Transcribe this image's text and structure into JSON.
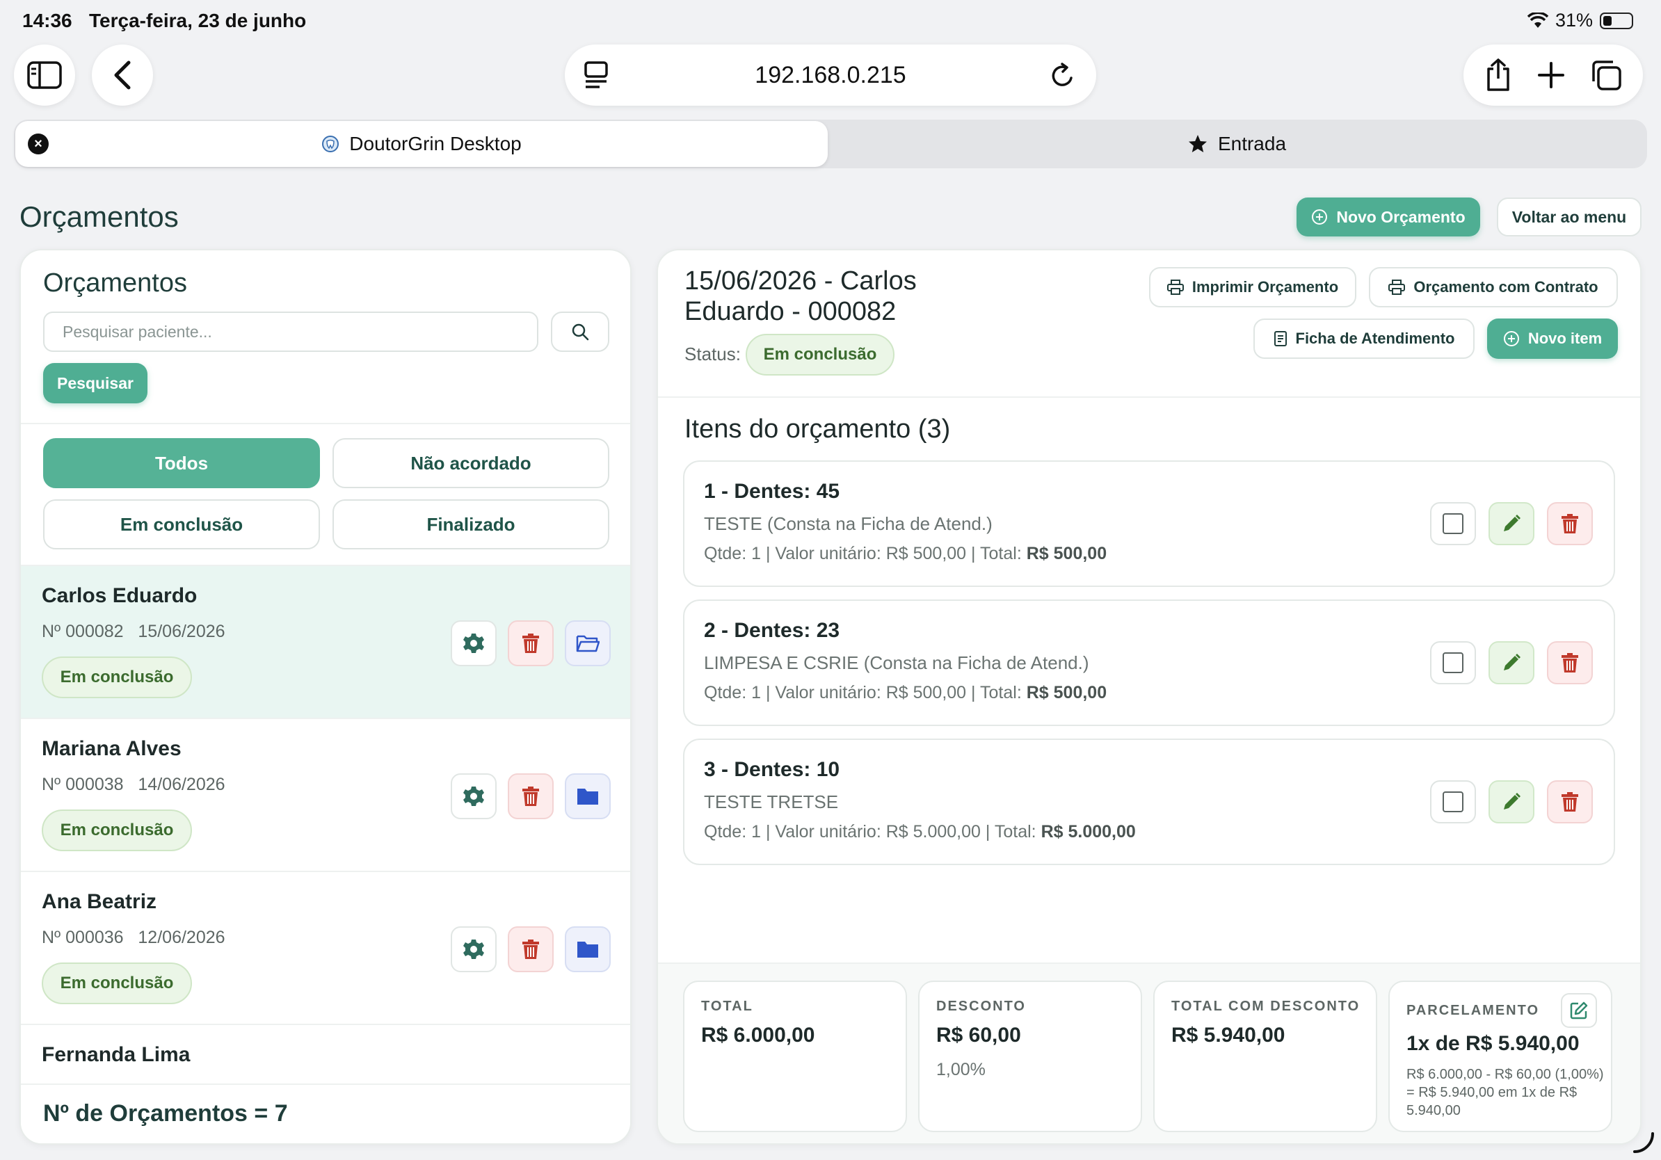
{
  "status_bar": {
    "time": "14:36",
    "date": "Terça-feira, 23 de junho",
    "battery": "31%"
  },
  "browser": {
    "url": "192.168.0.215",
    "tabs": [
      {
        "label": "DoutorGrin Desktop",
        "active": true
      },
      {
        "label": "Entrada",
        "active": false
      }
    ]
  },
  "page": {
    "title": "Orçamentos",
    "new_button": "Novo Orçamento",
    "back_button": "Voltar ao menu"
  },
  "sidebar": {
    "heading": "Orçamentos",
    "search_placeholder": "Pesquisar paciente...",
    "search_button": "Pesquisar",
    "filters": [
      "Todos",
      "Não acordado",
      "Em conclusão",
      "Finalizado"
    ],
    "active_filter": "Todos",
    "items": [
      {
        "name": "Carlos Eduardo",
        "number": "Nº 000082",
        "date": "15/06/2026",
        "status": "Em conclusão",
        "selected": true
      },
      {
        "name": "Mariana Alves",
        "number": "Nº 000038",
        "date": "14/06/2026",
        "status": "Em conclusão",
        "selected": false
      },
      {
        "name": "Ana Beatriz",
        "number": "Nº 000036",
        "date": "12/06/2026",
        "status": "Em conclusão",
        "selected": false
      },
      {
        "name": "Fernanda Lima",
        "number": "",
        "date": "",
        "status": "",
        "selected": false
      }
    ],
    "footer": "Nº de Orçamentos = 7"
  },
  "detail": {
    "title_line1": "15/06/2026 - Carlos",
    "title_line2": "Eduardo - 000082",
    "status_label": "Status:",
    "status_value": "Em conclusão",
    "buttons": {
      "print": "Imprimir Orçamento",
      "contract": "Orçamento com Contrato",
      "sheet": "Ficha de Atendimento",
      "new_item": "Novo item"
    },
    "items_heading": "Itens do orçamento (3)",
    "items": [
      {
        "title": "1 - Dentes: 45",
        "desc": "TESTE (Consta na Ficha de Atend.)",
        "qty": "Qtde: 1 | Valor unitário: R$ 500,00 | Total:",
        "total": "R$ 500,00"
      },
      {
        "title": "2 - Dentes: 23",
        "desc": "LIMPESA E CSRIE (Consta na Ficha de Atend.)",
        "qty": "Qtde: 1 | Valor unitário: R$ 500,00 | Total:",
        "total": "R$ 500,00"
      },
      {
        "title": "3 - Dentes: 10",
        "desc": "TESTE TRETSE",
        "qty": "Qtde: 1 | Valor unitário: R$ 5.000,00 | Total:",
        "total": "R$ 5.000,00"
      }
    ],
    "summary": {
      "total_label": "TOTAL",
      "total_value": "R$ 6.000,00",
      "discount_label": "DESCONTO",
      "discount_value": "R$ 60,00",
      "discount_pct": "1,00%",
      "total_disc_label": "TOTAL COM DESCONTO",
      "total_disc_value": "R$ 5.940,00",
      "parc_label": "PARCELAMENTO",
      "parc_value": "1x de R$ 5.940,00",
      "parc_note": "R$ 6.000,00 - R$ 60,00 (1,00%) = R$ 5.940,00 em 1x de R$ 5.940,00"
    }
  },
  "colors": {
    "primary": "#4fae93",
    "danger": "#c0392b",
    "success_badge": "#ebf6e7",
    "folder_blue": "#2f56c9"
  }
}
